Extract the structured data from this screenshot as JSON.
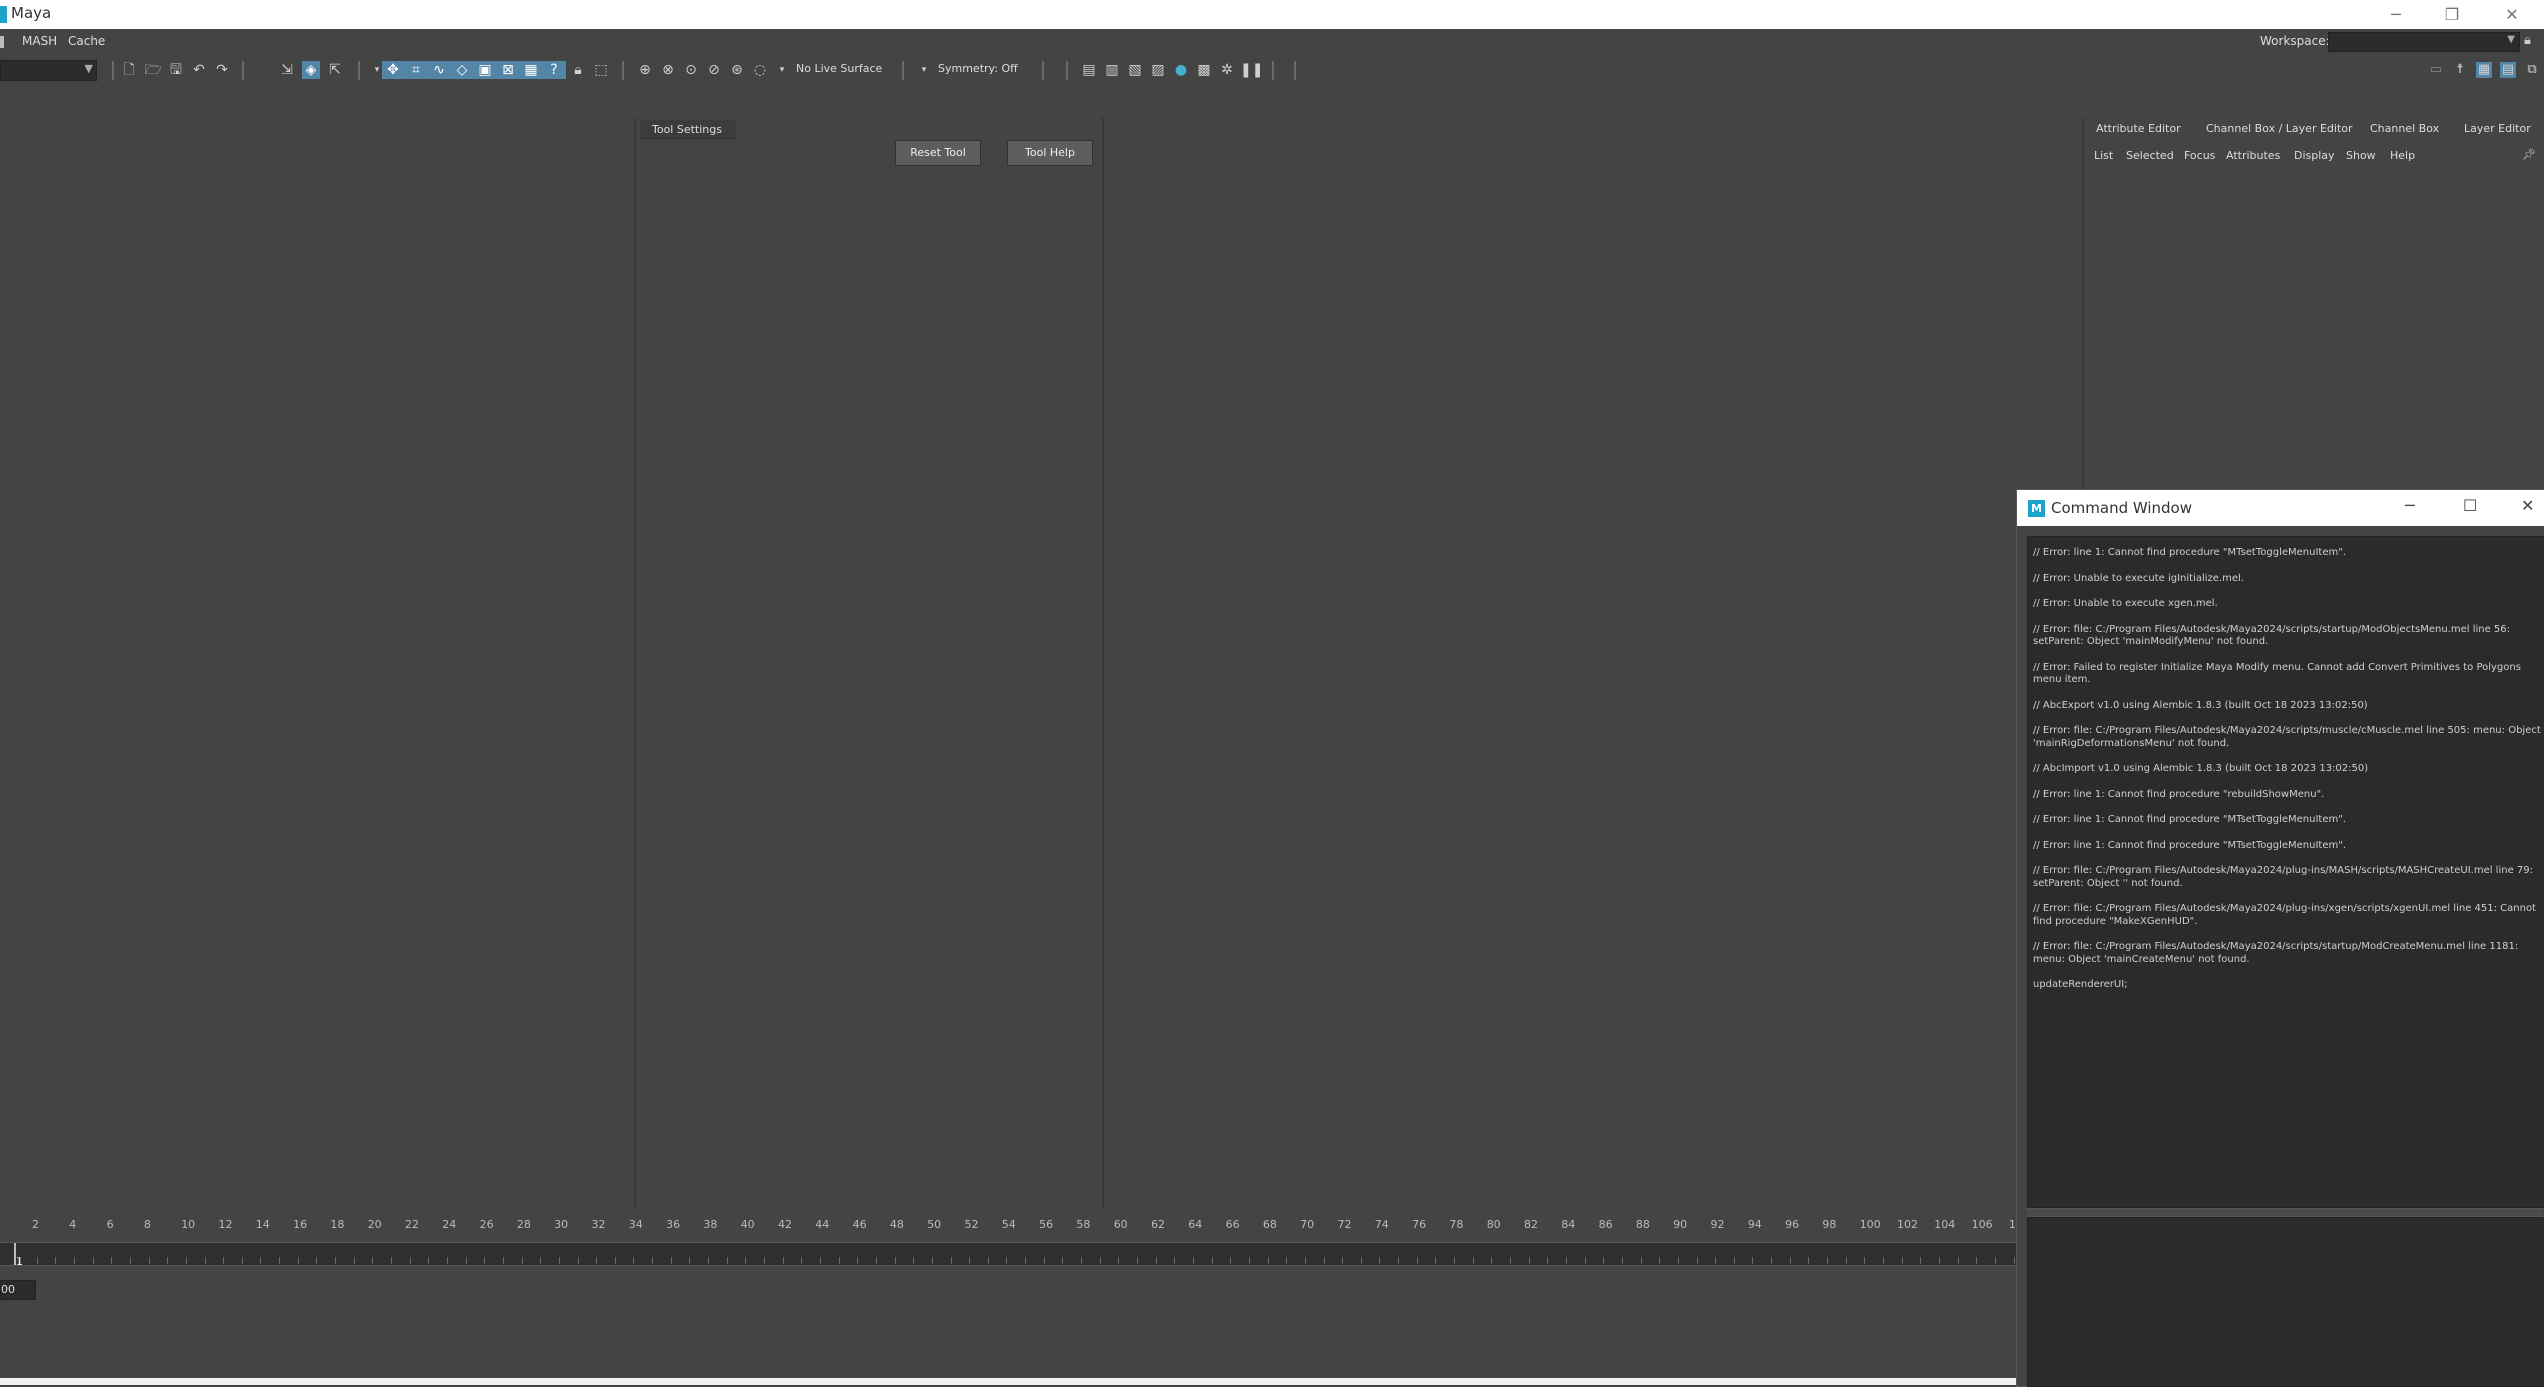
{
  "window": {
    "title": "Maya",
    "minimize": "─",
    "restore": "❐",
    "close": "✕"
  },
  "menubar": {
    "items": [
      "MASH",
      "Cache"
    ],
    "workspace_label": "Workspace:"
  },
  "toolbar": {
    "live_surface": "No Live Surface",
    "symmetry": "Symmetry: Off"
  },
  "tool_settings": {
    "tab": "Tool Settings",
    "reset_button": "Reset Tool",
    "help_button": "Tool Help"
  },
  "attribute_editor": {
    "tabs": [
      "Attribute Editor",
      "Channel Box / Layer Editor",
      "Channel Box",
      "Layer Editor"
    ],
    "menu": [
      "List",
      "Selected",
      "Focus",
      "Attributes",
      "Display",
      "Show",
      "Help"
    ]
  },
  "command_window": {
    "title": "Command Window",
    "icon": "M",
    "lines": [
      "// Error: line 1: Cannot find procedure \"MTsetToggleMenuItem\".",
      "// Error: Unable to execute igInitialize.mel.",
      "// Error: Unable to execute xgen.mel.",
      "// Error: file: C:/Program Files/Autodesk/Maya2024/scripts/startup/ModObjectsMenu.mel line 56: setParent: Object 'mainModifyMenu' not found.",
      "// Error: Failed to register Initialize Maya Modify menu. Cannot add Convert Primitives to Polygons menu item.",
      "// AbcExport v1.0 using Alembic 1.8.3 (built Oct 18 2023 13:02:50)",
      "// Error: file: C:/Program Files/Autodesk/Maya2024/scripts/muscle/cMuscle.mel line 505: menu: Object 'mainRigDeformationsMenu' not found.",
      "// AbcImport v1.0 using Alembic 1.8.3 (built Oct 18 2023 13:02:50)",
      "// Error: line 1: Cannot find procedure \"rebuildShowMenu\".",
      "// Error: line 1: Cannot find procedure \"MTsetToggleMenuItem\".",
      "// Error: line 1: Cannot find procedure \"MTsetToggleMenuItem\".",
      "// Error: file: C:/Program Files/Autodesk/Maya2024/plug-ins/MASH/scripts/MASHCreateUI.mel line 79: setParent: Object '' not found.",
      "// Error: file: C:/Program Files/Autodesk/Maya2024/plug-ins/xgen/scripts/xgenUI.mel line 451: Cannot find procedure \"MakeXGenHUD\".",
      "// Error: file: C:/Program Files/Autodesk/Maya2024/scripts/startup/ModCreateMenu.mel line 1181: menu: Object 'mainCreateMenu' not found.",
      "updateRendererUI;"
    ]
  },
  "timeline": {
    "ticks": [
      "2",
      "4",
      "6",
      "8",
      "10",
      "12",
      "14",
      "16",
      "18",
      "20",
      "22",
      "24",
      "26",
      "28",
      "30",
      "32",
      "34",
      "36",
      "38",
      "40",
      "42",
      "44",
      "46",
      "48",
      "50",
      "52",
      "54",
      "56",
      "58",
      "60",
      "62",
      "64",
      "66",
      "68",
      "70",
      "72",
      "74",
      "76",
      "78",
      "80",
      "82",
      "84",
      "86",
      "88",
      "90",
      "92",
      "94",
      "96",
      "98",
      "100",
      "102",
      "104",
      "106",
      "1"
    ],
    "current_frame": "1",
    "start_value": "00"
  }
}
